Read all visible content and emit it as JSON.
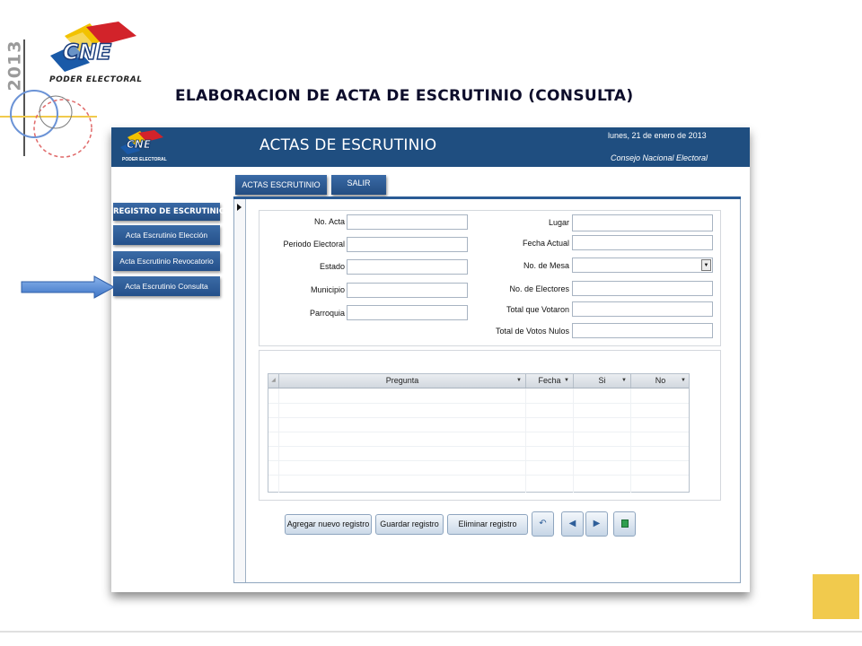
{
  "slide": {
    "year": "2013",
    "logo_text": "CNE",
    "logo_caption": "PODER ELECTORAL",
    "title": "ELABORACION  DE ACTA  DE ESCRUTINIO  (CONSULTA)"
  },
  "app": {
    "logo_text": "CNE",
    "logo_caption": "PODER ELECTORAL",
    "title": "ACTAS DE ESCRUTINIO",
    "date": "lunes, 21 de enero de 2013",
    "org": "Consejo Nacional Electoral"
  },
  "tabs": [
    "ACTAS ESCRUTINIO",
    "SALIR"
  ],
  "sidebar": {
    "header": "REGISTRO DE ESCRUTINIO",
    "items": [
      "Acta Escrutinio Elección",
      "Acta Escrutinio Revocatorio",
      "Acta Escrutinio Consulta"
    ]
  },
  "form": {
    "left": [
      {
        "label": "No. Acta",
        "value": ""
      },
      {
        "label": "Periodo Electoral",
        "value": ""
      },
      {
        "label": "Estado",
        "value": ""
      },
      {
        "label": "Municipio",
        "value": ""
      },
      {
        "label": "Parroquia",
        "value": ""
      }
    ],
    "right": [
      {
        "label": "Lugar",
        "value": ""
      },
      {
        "label": "Fecha Actual",
        "value": ""
      },
      {
        "label": "No. de Mesa",
        "value": ""
      },
      {
        "label": "No. de Electores",
        "value": ""
      },
      {
        "label": "Total que Votaron",
        "value": ""
      },
      {
        "label": "Total de Votos Nulos",
        "value": ""
      }
    ]
  },
  "grid": {
    "columns": [
      "Pregunta",
      "Fecha",
      "Si",
      "No"
    ]
  },
  "actions": [
    "Agregar nuevo registro",
    "Guardar registro",
    "Eliminar registro"
  ],
  "nav_icons": [
    "undo-icon",
    "previous-icon",
    "next-icon",
    "stop-icon"
  ],
  "colors": {
    "header_blue": "#1f4e80",
    "button_blue": "#2e5e99",
    "accent_yellow": "#f1ca4d"
  }
}
